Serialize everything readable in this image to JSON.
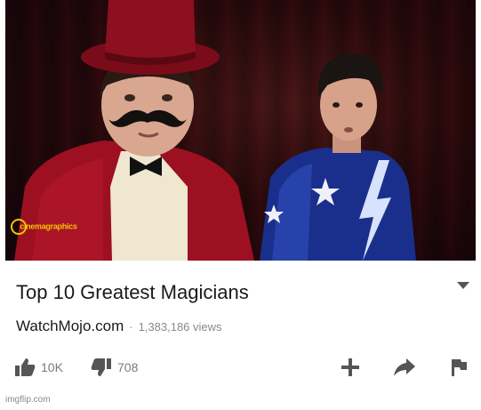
{
  "video": {
    "title": "Top 10 Greatest Magicians",
    "channel": "WatchMojo.com",
    "separator": "·",
    "views": "1,383,186 views",
    "thumbnail_watermark": "cinemagraphics"
  },
  "actions": {
    "like_count": "10K",
    "dislike_count": "708"
  },
  "footer": {
    "credit": "imgflip.com"
  },
  "colors": {
    "text_primary": "#1a1a1a",
    "text_secondary": "#8a8a8a",
    "icon": "#555555",
    "sequin_red": "#9c1022",
    "costume_blue": "#1a2f8c",
    "watermark": "#f2c400"
  }
}
